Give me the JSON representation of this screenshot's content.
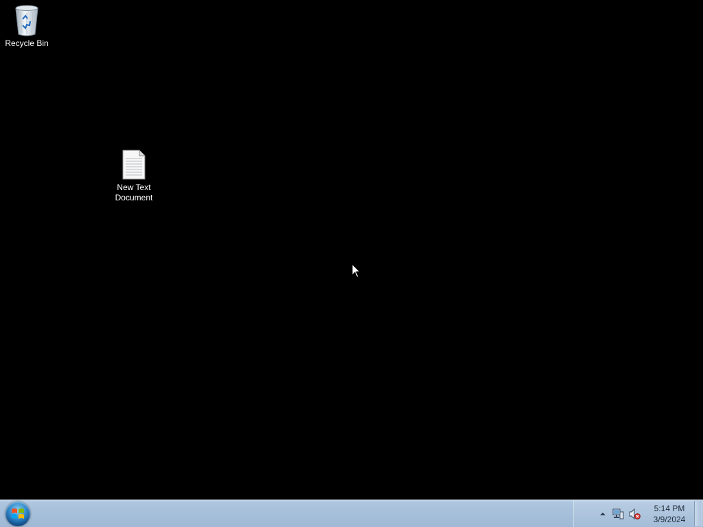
{
  "desktop": {
    "background_color": "#000000",
    "icons": [
      {
        "label": "Recycle Bin",
        "icon": "recycle-bin-icon"
      },
      {
        "label": "New Text Document",
        "icon": "text-document-icon"
      }
    ]
  },
  "taskbar": {
    "start_icon": "windows-start-orb-icon",
    "tray": {
      "expand_icon": "chevron-up-icon",
      "network_icon": "network-icon",
      "volume_icon": "volume-muted-icon"
    },
    "clock": {
      "time": "5:14 PM",
      "date": "3/9/2024"
    },
    "colors": {
      "bar": "#a6bfda"
    }
  }
}
